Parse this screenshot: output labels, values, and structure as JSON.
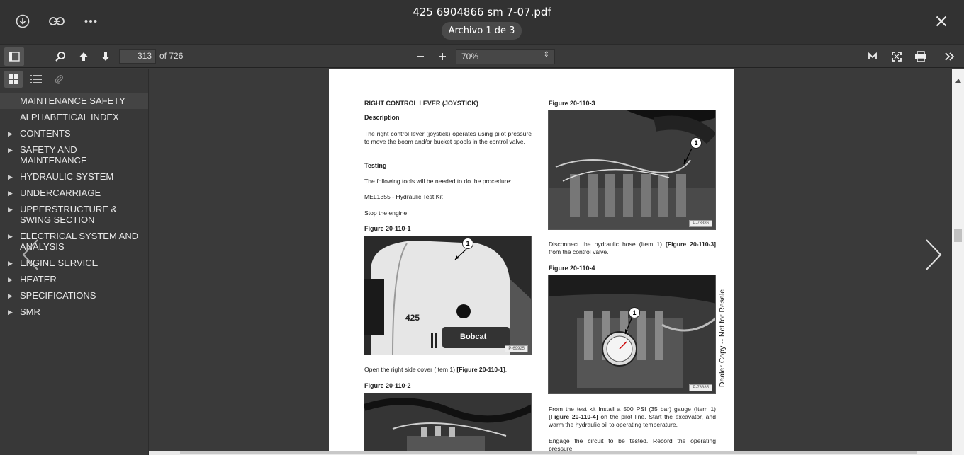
{
  "header": {
    "title": "425 6904866 sm 7-07.pdf",
    "file_indicator": "Archivo 1 de 3"
  },
  "toolbar": {
    "page_number": "313",
    "page_total": "of 726",
    "zoom": "70%"
  },
  "sidebar": {
    "items": [
      {
        "label": "MAINTENANCE SAFETY",
        "expandable": false,
        "selected": true
      },
      {
        "label": "ALPHABETICAL INDEX",
        "expandable": false
      },
      {
        "label": "CONTENTS",
        "expandable": true
      },
      {
        "label": "SAFETY AND MAINTENANCE",
        "expandable": true
      },
      {
        "label": "HYDRAULIC SYSTEM",
        "expandable": true
      },
      {
        "label": "UNDERCARRIAGE",
        "expandable": true
      },
      {
        "label": "UPPERSTRUCTURE & SWING SECTION",
        "expandable": true
      },
      {
        "label": "ELECTRICAL SYSTEM AND ANALYSIS",
        "expandable": true
      },
      {
        "label": "ENGINE SERVICE",
        "expandable": true
      },
      {
        "label": "HEATER",
        "expandable": true
      },
      {
        "label": "SPECIFICATIONS",
        "expandable": true
      },
      {
        "label": "SMR",
        "expandable": true
      }
    ]
  },
  "document": {
    "heading": "RIGHT CONTROL LEVER (JOYSTICK)",
    "description_heading": "Description",
    "description_text": "The right control lever (joystick) operates using pilot pressure to move the boom and/or bucket spools in the control valve.",
    "testing_heading": "Testing",
    "tools_text": "The following tools will be needed to do the procedure:",
    "tool_item": "MEL1355 - Hydraulic Test Kit",
    "stop_text": "Stop the engine.",
    "fig1_label": "Figure 20-110-1",
    "fig1_code": "P-69925",
    "fig1_model": "425",
    "fig1_brand": "Bobcat",
    "open_text_pre": "Open the right side cover (Item 1) ",
    "open_text_ref": "[Figure 20-110-1]",
    "open_text_post": ".",
    "fig2_label": "Figure 20-110-2",
    "fig3_label": "Figure 20-110-3",
    "fig3_code": "P-73386",
    "disconnect_pre": "Disconnect the hydraulic hose (Item 1) ",
    "disconnect_ref": "[Figure 20-110-3]",
    "disconnect_post": " from the control valve.",
    "fig4_label": "Figure 20-110-4",
    "fig4_code": "P-73385",
    "install_pre": "From the test kit Install a 500 PSI (35 bar) gauge (Item 1) ",
    "install_ref": "[Figure 20-110-4]",
    "install_post": " on the pilot line. Start the excavator, and warm the hydraulic oil to operating temperature.",
    "engage_text": "Engage the circuit to be tested. Record the operating pressure.",
    "callout": "1",
    "watermark": "Dealer Copy -- Not for Resale"
  },
  "colors": {
    "topbar": "#323232",
    "viewer_bg": "#3a3a3a",
    "page_bg": "#ffffff"
  }
}
